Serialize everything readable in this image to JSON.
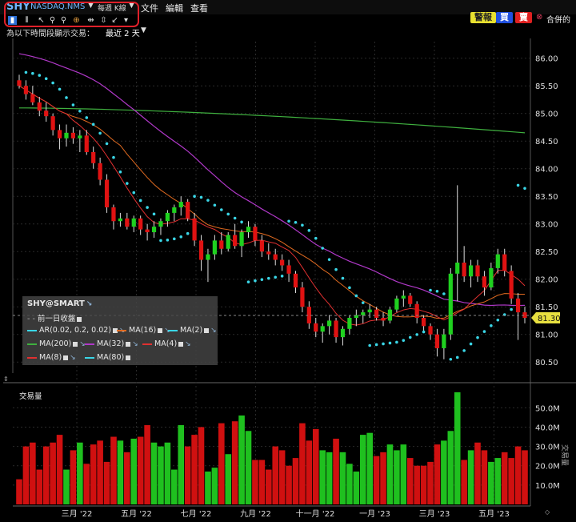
{
  "header": {
    "symbol": "SHY",
    "exchange": "NASDAQ.NMS",
    "period": "每週 K線",
    "menu_file": "文件",
    "menu_edit": "編輯",
    "menu_view": "查看",
    "alert_button": "警報",
    "buy_button": "買",
    "sell_button": "賣",
    "merged_label": "合併的",
    "subbar_prefix": "為以下時間段顯示交易：",
    "subbar_range": "最近 2 天"
  },
  "colors": {
    "up": "#1fd11f",
    "down": "#e01212",
    "ar": "#3ad6e6",
    "ma16": "#e06a20",
    "ma32": "#b038c8",
    "ma200": "#3fb03f",
    "ma8": "#e03030",
    "volume_up": "#1fc01f",
    "volume_down": "#d01010"
  },
  "legend": {
    "title": "SHY@SMART",
    "prev_close": "前一日收盤",
    "items": [
      {
        "label": "AR(0.02, 0.2, 0.02)",
        "color": "#3ad6e6"
      },
      {
        "label": "MA(16)",
        "color": "#e06a20"
      },
      {
        "label": "MA(2)",
        "color": "#3ad6e6"
      },
      {
        "label": "MA(200)",
        "color": "#3fb03f"
      },
      {
        "label": "MA(32)",
        "color": "#b038c8"
      },
      {
        "label": "MA(4)",
        "color": "#e03030"
      },
      {
        "label": "MA(8)",
        "color": "#e03030"
      },
      {
        "label": "MA(80)",
        "color": "#3ad6e6"
      }
    ]
  },
  "volume_panel": {
    "title": "交易量",
    "axis_unit": "交易量"
  },
  "chart_data": {
    "type": "candlestick",
    "last_price": "81.30",
    "price_ticks": [
      "86.00",
      "85.50",
      "85.00",
      "84.50",
      "84.00",
      "83.50",
      "83.00",
      "82.50",
      "82.00",
      "81.50",
      "81.00",
      "80.50"
    ],
    "volume_ticks": [
      "50.0M",
      "40.0M",
      "30.0M",
      "20.0M",
      "10.0M"
    ],
    "x_ticks": [
      "三月 '22",
      "五月 '22",
      "七月 '22",
      "九月 '22",
      "十一月 '22",
      "一月 '23",
      "三月 '23",
      "五月 '23"
    ],
    "ylim": [
      80.3,
      86.3
    ],
    "volume_ylim": [
      0,
      58
    ],
    "candles": [
      [
        85.6,
        85.7,
        85.45,
        85.5
      ],
      [
        85.5,
        85.6,
        85.25,
        85.35
      ],
      [
        85.35,
        85.5,
        85.15,
        85.2
      ],
      [
        85.2,
        85.3,
        84.95,
        85.05
      ],
      [
        85.05,
        85.2,
        84.85,
        84.95
      ],
      [
        84.95,
        85.0,
        84.6,
        84.7
      ],
      [
        84.7,
        84.8,
        84.35,
        84.55
      ],
      [
        84.55,
        84.8,
        84.4,
        84.65
      ],
      [
        84.65,
        84.75,
        84.45,
        84.55
      ],
      [
        84.55,
        84.7,
        84.3,
        84.6
      ],
      [
        84.6,
        84.7,
        84.25,
        84.3
      ],
      [
        84.3,
        84.4,
        84.0,
        84.1
      ],
      [
        84.1,
        84.2,
        83.7,
        83.8
      ],
      [
        83.8,
        83.9,
        83.2,
        83.3
      ],
      [
        83.3,
        83.35,
        82.9,
        83.05
      ],
      [
        83.05,
        83.2,
        82.95,
        83.1
      ],
      [
        83.1,
        83.2,
        82.9,
        82.95
      ],
      [
        82.95,
        83.15,
        82.85,
        83.1
      ],
      [
        83.1,
        83.15,
        82.8,
        82.9
      ],
      [
        82.9,
        83.0,
        82.7,
        82.85
      ],
      [
        82.85,
        83.05,
        82.75,
        82.95
      ],
      [
        82.95,
        83.1,
        82.8,
        83.05
      ],
      [
        83.05,
        83.25,
        82.95,
        83.2
      ],
      [
        83.2,
        83.35,
        83.05,
        83.3
      ],
      [
        83.3,
        83.5,
        83.15,
        83.4
      ],
      [
        83.4,
        83.45,
        83.05,
        83.1
      ],
      [
        83.1,
        83.2,
        82.6,
        82.7
      ],
      [
        82.7,
        82.8,
        82.15,
        82.35
      ],
      [
        82.35,
        82.55,
        81.95,
        82.45
      ],
      [
        82.45,
        82.8,
        82.35,
        82.7
      ],
      [
        82.7,
        82.85,
        82.45,
        82.55
      ],
      [
        82.55,
        82.85,
        82.5,
        82.8
      ],
      [
        82.8,
        83.0,
        82.55,
        82.6
      ],
      [
        82.6,
        82.9,
        82.4,
        82.85
      ],
      [
        82.85,
        83.05,
        82.75,
        82.95
      ],
      [
        82.95,
        83.0,
        82.6,
        82.7
      ],
      [
        82.7,
        82.8,
        82.4,
        82.5
      ],
      [
        82.5,
        82.65,
        82.35,
        82.45
      ],
      [
        82.45,
        82.55,
        82.25,
        82.35
      ],
      [
        82.35,
        82.45,
        82.15,
        82.25
      ],
      [
        82.25,
        82.35,
        81.95,
        82.1
      ],
      [
        82.1,
        82.15,
        81.75,
        81.85
      ],
      [
        81.85,
        81.95,
        81.4,
        81.5
      ],
      [
        81.5,
        81.6,
        81.1,
        81.2
      ],
      [
        81.2,
        81.3,
        80.95,
        81.05
      ],
      [
        81.05,
        81.2,
        80.85,
        81.15
      ],
      [
        81.15,
        81.35,
        81.0,
        81.25
      ],
      [
        81.25,
        81.3,
        80.85,
        80.95
      ],
      [
        80.95,
        81.15,
        80.8,
        81.1
      ],
      [
        81.1,
        81.35,
        81.0,
        81.3
      ],
      [
        81.3,
        81.45,
        81.15,
        81.35
      ],
      [
        81.35,
        81.45,
        81.2,
        81.4
      ],
      [
        81.4,
        81.55,
        81.3,
        81.45
      ],
      [
        81.45,
        81.5,
        81.25,
        81.3
      ],
      [
        81.3,
        81.4,
        81.15,
        81.25
      ],
      [
        81.25,
        81.5,
        81.2,
        81.45
      ],
      [
        81.45,
        81.7,
        81.4,
        81.65
      ],
      [
        81.65,
        81.8,
        81.5,
        81.7
      ],
      [
        81.7,
        81.75,
        81.5,
        81.55
      ],
      [
        81.55,
        81.6,
        81.2,
        81.3
      ],
      [
        81.3,
        81.35,
        81.05,
        81.15
      ],
      [
        81.15,
        81.2,
        80.9,
        81.0
      ],
      [
        81.0,
        81.1,
        80.6,
        80.75
      ],
      [
        80.75,
        81.1,
        80.55,
        81.0
      ],
      [
        81.0,
        82.2,
        80.9,
        82.1
      ],
      [
        82.1,
        83.7,
        81.6,
        82.3
      ],
      [
        82.3,
        82.6,
        81.95,
        82.05
      ],
      [
        82.05,
        82.35,
        81.85,
        82.25
      ],
      [
        82.25,
        82.35,
        81.95,
        82.05
      ],
      [
        82.05,
        82.15,
        81.7,
        81.85
      ],
      [
        81.85,
        82.3,
        81.8,
        82.2
      ],
      [
        82.2,
        82.55,
        82.1,
        82.45
      ],
      [
        82.45,
        82.55,
        82.05,
        82.15
      ],
      [
        82.15,
        82.25,
        81.55,
        81.65
      ],
      [
        81.65,
        81.75,
        80.9,
        81.4
      ],
      [
        81.4,
        81.5,
        81.2,
        81.3
      ]
    ],
    "volumes": [
      13,
      30,
      32,
      18,
      30,
      32,
      36,
      18,
      28,
      32,
      21,
      31,
      33,
      22,
      35,
      33,
      27,
      34,
      35,
      41,
      32,
      30,
      32,
      18,
      41,
      30,
      36,
      40,
      17,
      19,
      42,
      26,
      43,
      46,
      38,
      23,
      23,
      18,
      30,
      28,
      20,
      24,
      42,
      33,
      39,
      28,
      27,
      34,
      27,
      21,
      17,
      36,
      37,
      25,
      27,
      31,
      28,
      31,
      24,
      20,
      20,
      22,
      31,
      33,
      38,
      58,
      23,
      28,
      32,
      28,
      22,
      24,
      27,
      24,
      30,
      28
    ]
  }
}
